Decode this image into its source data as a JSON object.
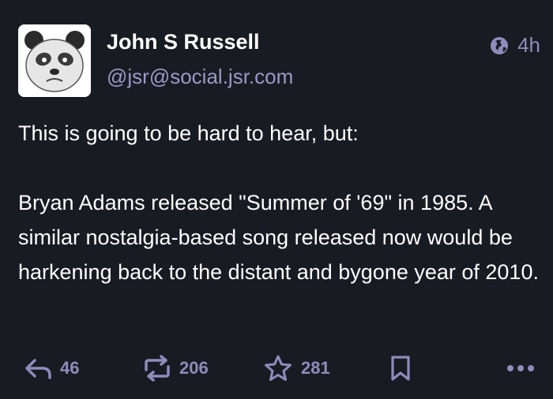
{
  "author": {
    "display_name": "John S Russell",
    "handle": "@jsr@social.jsr.com",
    "avatar_icon": "panda-avatar"
  },
  "meta": {
    "visibility_icon": "globe-icon",
    "relative_time": "4h"
  },
  "status": {
    "paragraphs": [
      "This is going to be hard to hear, but:",
      "Bryan Adams released \"Summer of '69\" in 1985. A similar nostalgia-based song released now would be harkening back to the distant and bygone year of 2010."
    ]
  },
  "actions": {
    "reply": {
      "icon": "reply-icon",
      "count": "46"
    },
    "boost": {
      "icon": "boost-icon",
      "count": "206"
    },
    "favourite": {
      "icon": "star-icon",
      "count": "281"
    },
    "bookmark": {
      "icon": "bookmark-icon"
    },
    "more": {
      "icon": "more-icon"
    }
  },
  "colors": {
    "background": "#191b22",
    "text": "#ffffff",
    "muted": "#8e8cbd",
    "handle": "#9a99c8"
  }
}
